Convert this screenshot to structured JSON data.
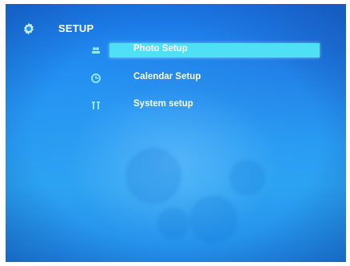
{
  "header": {
    "title": "SETUP",
    "icon": "gear-icon"
  },
  "menu": {
    "items": [
      {
        "label": "Photo Setup",
        "icon": "photo-icon",
        "selected": true
      },
      {
        "label": "Calendar Setup",
        "icon": "clock-icon",
        "selected": false
      },
      {
        "label": "System setup",
        "icon": "system-icon",
        "selected": false
      }
    ]
  },
  "colors": {
    "background": "#2596f3",
    "highlight": "#4fe0f5",
    "text": "#ffffff",
    "icon": "#8fe8ff"
  }
}
